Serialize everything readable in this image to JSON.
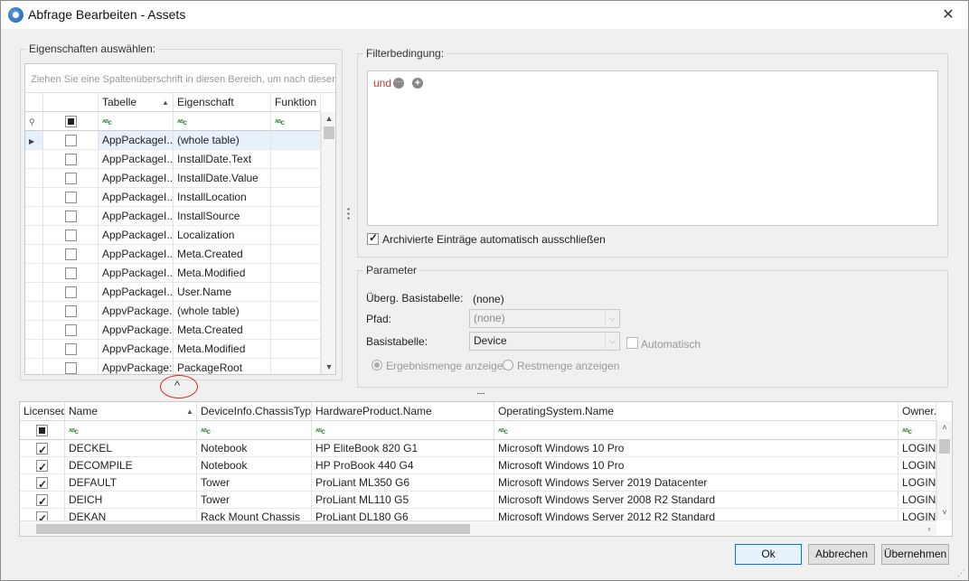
{
  "window": {
    "title": "Abfrage Bearbeiten - Assets",
    "close": "✕"
  },
  "properties": {
    "legend": "Eigenschaften auswählen:",
    "group_hint": "Ziehen Sie eine Spaltenüberschrift in diesen Bereich, um nach dieser z",
    "columns": [
      "Tabelle",
      "Eigenschaft",
      "Funktion"
    ],
    "rows": [
      {
        "table": "AppPackageI...",
        "property": "(whole table)",
        "checked": false,
        "selected": true
      },
      {
        "table": "AppPackageI...",
        "property": "InstallDate.Text",
        "checked": false
      },
      {
        "table": "AppPackageI...",
        "property": "InstallDate.Value",
        "checked": false
      },
      {
        "table": "AppPackageI...",
        "property": "InstallLocation",
        "checked": false
      },
      {
        "table": "AppPackageI...",
        "property": "InstallSource",
        "checked": false
      },
      {
        "table": "AppPackageI...",
        "property": "Localization",
        "checked": false
      },
      {
        "table": "AppPackageI...",
        "property": "Meta.Created",
        "checked": false
      },
      {
        "table": "AppPackageI...",
        "property": "Meta.Modified",
        "checked": false
      },
      {
        "table": "AppPackageI...",
        "property": "User.Name",
        "checked": false
      },
      {
        "table": "AppvPackage...",
        "property": "(whole table)",
        "checked": false
      },
      {
        "table": "AppvPackage...",
        "property": "Meta.Created",
        "checked": false
      },
      {
        "table": "AppvPackage...",
        "property": "Meta.Modified",
        "checked": false
      },
      {
        "table": "AppvPackage:",
        "property": "PackageRoot",
        "checked": false
      }
    ]
  },
  "filter": {
    "legend": "Filterbedingung:",
    "operator": "und",
    "exclude_archived_label": "Archivierte Einträge automatisch ausschließen",
    "exclude_archived": true
  },
  "parameters": {
    "legend": "Parameter",
    "base_table_label": "Überg. Basistabelle:",
    "base_table_value": "(none)",
    "path_label": "Pfad:",
    "path_value": "(none)",
    "basistabelle_label": "Basistabelle:",
    "basistabelle_value": "Device",
    "automatic_label": "Automatisch",
    "show_results_label": "Ergebnismenge anzeigen",
    "show_rest_label": "Restmenge anzeigen"
  },
  "splitter": {
    "collapse_glyph": "^",
    "dots": "....."
  },
  "results": {
    "columns": [
      "Licensed",
      "Name",
      "DeviceInfo.ChassisType",
      "HardwareProduct.Name",
      "OperatingSystem.Name",
      "Owner.Nam"
    ],
    "rows": [
      {
        "licensed": true,
        "name": "DECKEL",
        "chassis": "Notebook",
        "hardware": "HP EliteBook 820 G1",
        "os": "Microsoft Windows 10 Pro",
        "owner": "LOGIN\\F"
      },
      {
        "licensed": true,
        "name": "DECOMPILE",
        "chassis": "Notebook",
        "hardware": "HP ProBook 440 G4",
        "os": "Microsoft Windows 10 Pro",
        "owner": "LOGIN\\F"
      },
      {
        "licensed": true,
        "name": "DEFAULT",
        "chassis": "Tower",
        "hardware": "ProLiant ML350 G6",
        "os": "Microsoft Windows Server 2019 Datacenter",
        "owner": "LOGIN\\s"
      },
      {
        "licensed": true,
        "name": "DEICH",
        "chassis": "Tower",
        "hardware": "ProLiant ML110 G5",
        "os": "Microsoft Windows Server 2008 R2 Standard",
        "owner": "LOGIN\\s"
      },
      {
        "licensed": true,
        "name": "DEKAN",
        "chassis": "Rack Mount Chassis",
        "hardware": "ProLiant DL180 G6",
        "os": "Microsoft Windows Server 2012 R2 Standard",
        "owner": "LOGIN\\s"
      }
    ]
  },
  "buttons": {
    "ok": "Ok",
    "cancel": "Abbrechen",
    "apply": "Übernehmen"
  }
}
